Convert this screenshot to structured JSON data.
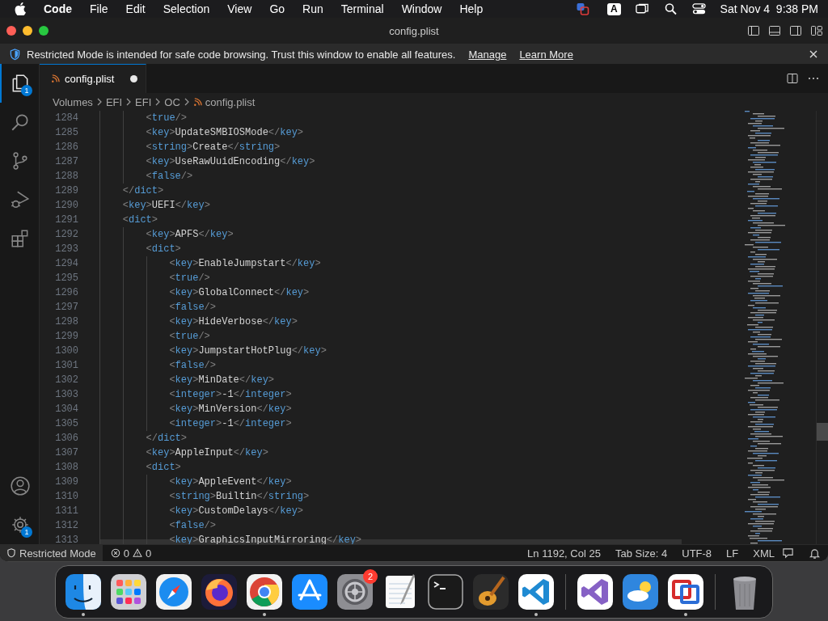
{
  "menu_bar": {
    "app": "Code",
    "items": [
      "File",
      "Edit",
      "Selection",
      "View",
      "Go",
      "Run",
      "Terminal",
      "Window",
      "Help"
    ],
    "input_source": "A",
    "clock": "Sat Nov 4  9:38 PM"
  },
  "window": {
    "title": "config.plist"
  },
  "banner": {
    "message": "Restricted Mode is intended for safe code browsing. Trust this window to enable all features.",
    "links": [
      "Manage",
      "Learn More"
    ]
  },
  "activity_bar": {
    "top": [
      {
        "kind": "explorer",
        "badge": "1",
        "selected": true
      },
      {
        "kind": "search",
        "selected": false
      },
      {
        "kind": "source-control",
        "selected": false
      },
      {
        "kind": "run-debug",
        "selected": false
      },
      {
        "kind": "extensions",
        "selected": false
      }
    ],
    "bottom": [
      {
        "kind": "accounts"
      },
      {
        "kind": "manage",
        "badge": "1"
      }
    ]
  },
  "tab": {
    "label": "config.plist",
    "modified": true
  },
  "breadcrumb": [
    "Volumes",
    "EFI",
    "EFI",
    "OC",
    "config.plist"
  ],
  "lines": [
    {
      "number": "1284",
      "text": "        <true/>"
    },
    {
      "number": "1285",
      "text": "        <key>UpdateSMBIOSMode</key>"
    },
    {
      "number": "1286",
      "text": "        <string>Create</string>"
    },
    {
      "number": "1287",
      "text": "        <key>UseRawUuidEncoding</key>"
    },
    {
      "number": "1288",
      "text": "        <false/>"
    },
    {
      "number": "1289",
      "text": "    </dict>"
    },
    {
      "number": "1290",
      "text": "    <key>UEFI</key>"
    },
    {
      "number": "1291",
      "text": "    <dict>"
    },
    {
      "number": "1292",
      "text": "        <key>APFS</key>"
    },
    {
      "number": "1293",
      "text": "        <dict>"
    },
    {
      "number": "1294",
      "text": "            <key>EnableJumpstart</key>"
    },
    {
      "number": "1295",
      "text": "            <true/>"
    },
    {
      "number": "1296",
      "text": "            <key>GlobalConnect</key>"
    },
    {
      "number": "1297",
      "text": "            <false/>"
    },
    {
      "number": "1298",
      "text": "            <key>HideVerbose</key>"
    },
    {
      "number": "1299",
      "text": "            <true/>"
    },
    {
      "number": "1300",
      "text": "            <key>JumpstartHotPlug</key>"
    },
    {
      "number": "1301",
      "text": "            <false/>"
    },
    {
      "number": "1302",
      "text": "            <key>MinDate</key>"
    },
    {
      "number": "1303",
      "text": "            <integer>-1</integer>"
    },
    {
      "number": "1304",
      "text": "            <key>MinVersion</key>"
    },
    {
      "number": "1305",
      "text": "            <integer>-1</integer>"
    },
    {
      "number": "1306",
      "text": "        </dict>"
    },
    {
      "number": "1307",
      "text": "        <key>AppleInput</key>"
    },
    {
      "number": "1308",
      "text": "        <dict>"
    },
    {
      "number": "1309",
      "text": "            <key>AppleEvent</key>"
    },
    {
      "number": "1310",
      "text": "            <string>Builtin</string>"
    },
    {
      "number": "1311",
      "text": "            <key>CustomDelays</key>"
    },
    {
      "number": "1312",
      "text": "            <false/>"
    },
    {
      "number": "1313",
      "text": "            <key>GraphicsInputMirroring</key>"
    }
  ],
  "status_bar": {
    "mode": "Restricted Mode",
    "errors": "0",
    "warnings": "0",
    "items": [
      "Ln 1192, Col 25",
      "Tab Size: 4",
      "UTF-8",
      "LF",
      "XML"
    ]
  },
  "dock": {
    "sections": [
      [
        {
          "kind": "finder",
          "running": true
        },
        {
          "kind": "launchpad",
          "running": false
        },
        {
          "kind": "safari",
          "running": false
        },
        {
          "kind": "firefox",
          "running": false
        },
        {
          "kind": "chrome",
          "running": true
        },
        {
          "kind": "app-store",
          "running": false
        },
        {
          "kind": "settings",
          "running": false,
          "badge": "2"
        },
        {
          "kind": "textedit",
          "running": false
        },
        {
          "kind": "terminal",
          "running": false
        },
        {
          "kind": "garageband",
          "running": false
        },
        {
          "kind": "vscode",
          "running": true
        }
      ],
      [
        {
          "kind": "visual-studio",
          "running": false
        },
        {
          "kind": "weather",
          "running": false
        },
        {
          "kind": "parallels",
          "running": true
        }
      ],
      [
        {
          "kind": "trash",
          "running": false
        }
      ]
    ]
  }
}
